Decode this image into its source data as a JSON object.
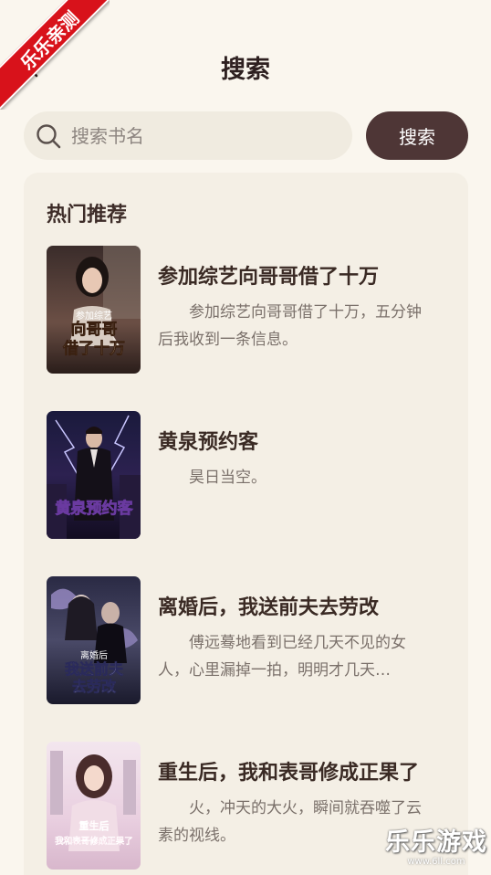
{
  "ribbon": {
    "text": "乐乐亲测"
  },
  "header": {
    "title": "搜索"
  },
  "search": {
    "placeholder": "搜索书名",
    "value": "",
    "button_label": "搜索"
  },
  "section": {
    "title": "热门推荐"
  },
  "books": [
    {
      "title": "参加综艺向哥哥借了十万",
      "description": "参加综艺向哥哥借了十万，五分钟后我收到一条信息。",
      "cover_text_top": "参加综艺",
      "cover_text_main": "向哥哥借了十万"
    },
    {
      "title": "黄泉预约客",
      "description": "昊日当空。",
      "cover_text_main": "黄泉预约客"
    },
    {
      "title": "离婚后，我送前夫去劳改",
      "description": "傅远蓦地看到已经几天不见的女人，心里漏掉一拍，明明才几天…",
      "cover_text_top": "离婚后",
      "cover_text_main": "我送前夫去劳改"
    },
    {
      "title": "重生后，我和表哥修成正果了",
      "description": "火，冲天的大火，瞬间就吞噬了云素的视线。",
      "cover_text_top": "重生后",
      "cover_text_main": "我和表哥修成正果了"
    }
  ],
  "watermark": {
    "main": "乐乐游戏",
    "sub": "www.6ll.com"
  },
  "colors": {
    "background": "#faf6ee",
    "panel": "#f4efe5",
    "button": "#4e3636",
    "ribbon": "#d8121b"
  }
}
